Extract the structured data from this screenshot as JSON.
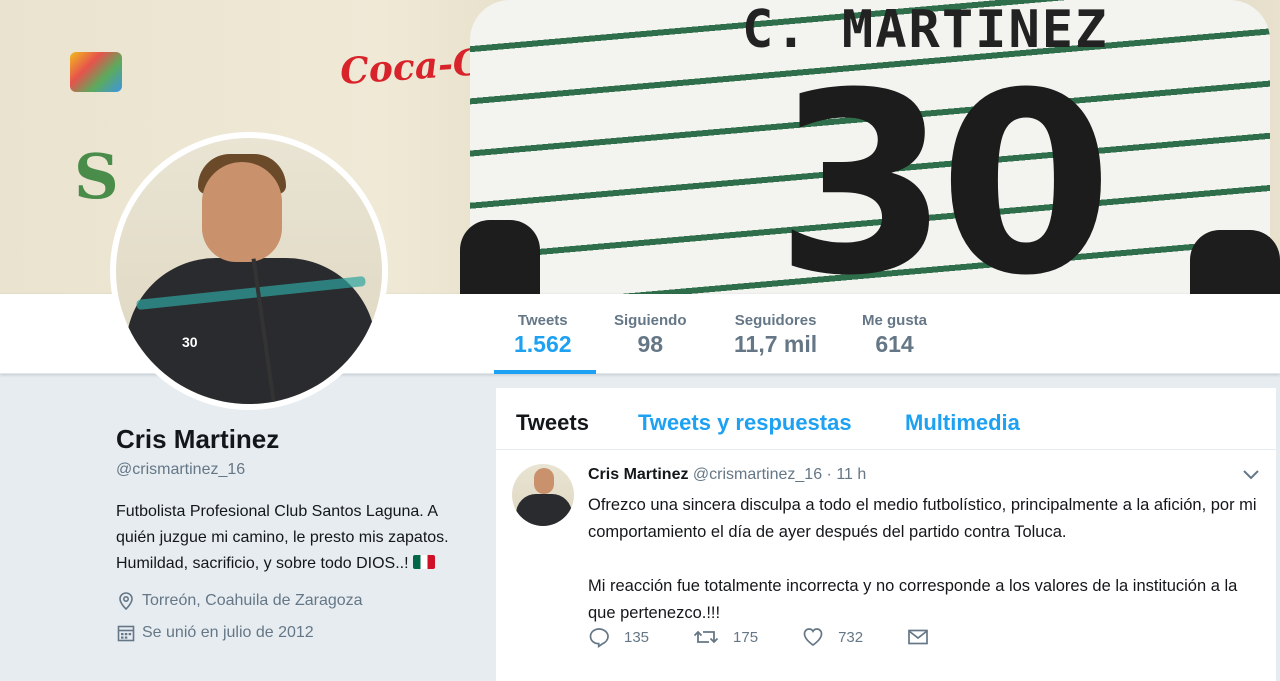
{
  "banner": {
    "jersey_name": "C. MARTINEZ",
    "jersey_number": "30",
    "sponsor_text": "Coca-Cola",
    "avatar_jersey_number": "30"
  },
  "stats": [
    {
      "label": "Tweets",
      "value": "1.562",
      "active": true
    },
    {
      "label": "Siguiendo",
      "value": "98",
      "active": false
    },
    {
      "label": "Seguidores",
      "value": "11,7 mil",
      "active": false
    },
    {
      "label": "Me gusta",
      "value": "614",
      "active": false
    }
  ],
  "profile": {
    "name": "Cris Martinez",
    "handle": "@crismartinez_16",
    "bio": "Futbolista Profesional Club Santos Laguna. A quién juzgue mi camino, le presto mis zapatos. Humildad, sacrificio, y sobre todo DIOS..!",
    "bio_flag_icon": "mexico-flag-icon",
    "location": "Torreón, Coahuila de Zaragoza",
    "joined": "Se unió en julio de 2012"
  },
  "timeline": {
    "tabs": [
      "Tweets",
      "Tweets y respuestas",
      "Multimedia"
    ],
    "active_tab": "Tweets"
  },
  "tweet": {
    "name": "Cris Martinez",
    "handle": "@crismartinez_16",
    "separator": "·",
    "time": "11 h",
    "paragraph_1": "Ofrezco una sincera disculpa a todo el medio futbolístico, principalmente a la afición, por mi comportamiento el día de ayer después del partido contra Toluca.",
    "paragraph_2": "Mi reacción fue totalmente incorrecta y no corresponde a los valores de la institución a la que pertenezco.!!!",
    "replies": "135",
    "retweets": "175",
    "likes": "732"
  },
  "colors": {
    "accent": "#1da1f2",
    "muted": "#657786",
    "text": "#14171a",
    "background": "#e6ecf0"
  }
}
